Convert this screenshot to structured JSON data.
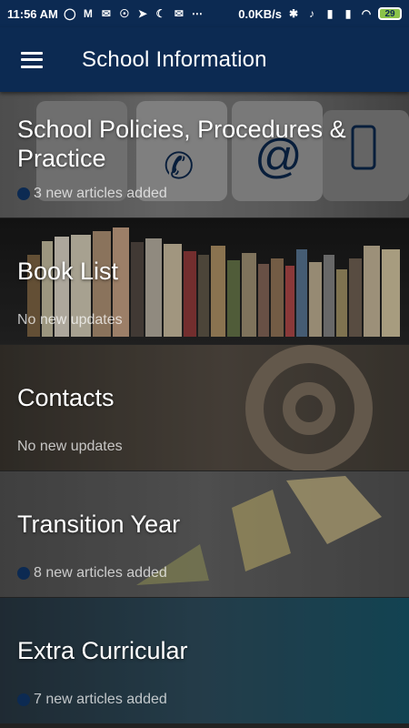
{
  "status": {
    "time": "11:56 AM",
    "speed": "0.0KB/s",
    "battery": "29",
    "icons_left": [
      "whatsapp-icon",
      "gmail-icon",
      "mail-icon",
      "brain-icon",
      "telegram-icon",
      "moon-icon",
      "envelope-icon",
      "more-icon"
    ],
    "icons_right": [
      "bluetooth-icon",
      "mute-icon",
      "signal-icon",
      "signal-icon",
      "wifi-icon",
      "battery-icon"
    ]
  },
  "app_bar": {
    "title": "School Information",
    "menu_icon": "hamburger-menu-icon"
  },
  "colors": {
    "primary": "#0c2a52",
    "dot": "#0c2a52"
  },
  "items": [
    {
      "title": "School Policies, Procedures & Practice",
      "subtitle": "3 new articles added",
      "dot": true
    },
    {
      "title": "Book List",
      "subtitle": "No new updates",
      "dot": false
    },
    {
      "title": "Contacts",
      "subtitle": "No new updates",
      "dot": false
    },
    {
      "title": "Transition Year",
      "subtitle": "8 new articles added",
      "dot": true
    },
    {
      "title": "Extra Curricular",
      "subtitle": "7 new articles added",
      "dot": true
    }
  ]
}
